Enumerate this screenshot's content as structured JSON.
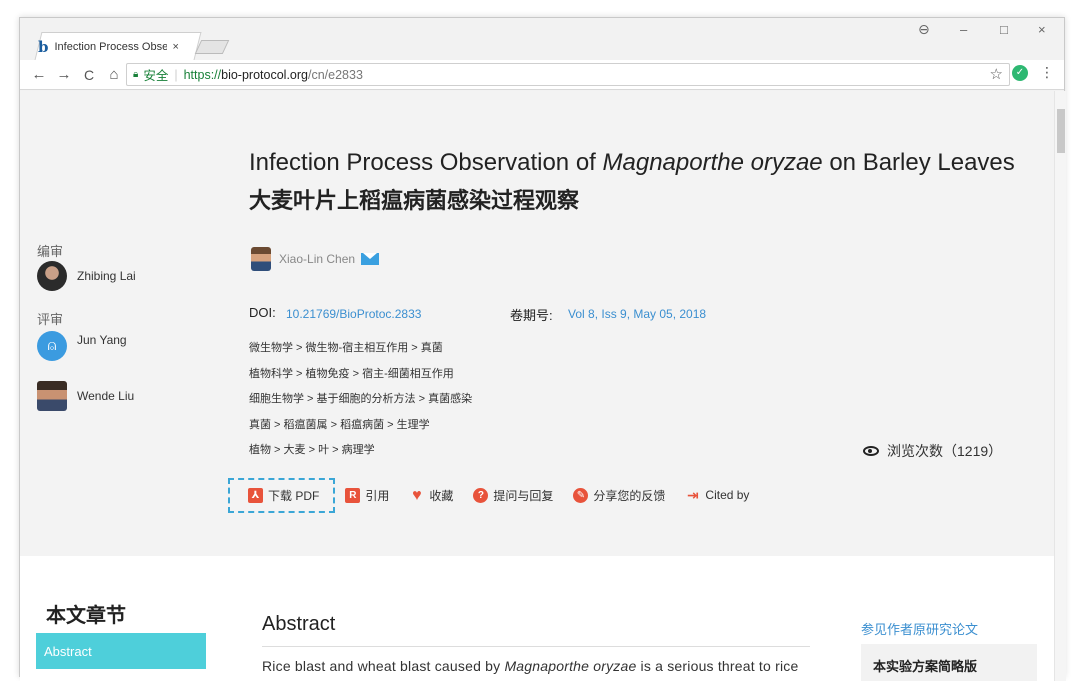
{
  "browser": {
    "tab_title": "Infection Process Obse",
    "tab_logo": "b",
    "tab_close": "×",
    "window_controls": [
      "–",
      "□",
      "×"
    ],
    "account_icon": "account-icon",
    "nav": {
      "back": "←",
      "forward": "→",
      "reload": "C",
      "home": "⌂"
    },
    "address": {
      "secure_label": "安全",
      "scheme": "https://",
      "host": "bio-protocol.org",
      "path": "/cn/e2833"
    },
    "bookmark_star": "☆",
    "menu": "⋮"
  },
  "article": {
    "title_en_before": "Infection Process Observation of ",
    "title_en_italic": "Magnaporthe oryzae",
    "title_en_after": " on Barley Leaves",
    "title_cn": "大麦叶片上稻瘟病菌感染过程观察",
    "author": "Xiao-Lin Chen",
    "doi_label": "DOI:",
    "doi": "10.21769/BioProtoc.2833",
    "issue_label": "卷期号:",
    "issue": "Vol 8, Iss 9, May 05, 2018",
    "categories": [
      "微生物学 > 微生物-宿主相互作用 > 真菌",
      "植物科学 > 植物免疫 > 宿主-细菌相互作用",
      "细胞生物学 > 基于细胞的分析方法 > 真菌感染",
      "真菌 > 稻瘟菌属 > 稻瘟病菌 > 生理学",
      "植物 > 大麦 > 叶 > 病理学"
    ],
    "views_label": "浏览次数（1219）"
  },
  "sidebar": {
    "editor_heading": "编审",
    "editors": [
      "Zhibing Lai"
    ],
    "reviewer_heading": "评审",
    "reviewers": [
      "Jun Yang",
      "Wende Liu"
    ]
  },
  "actions": [
    {
      "label": "下载 PDF",
      "icon": "pdf-icon",
      "color": "#e8533b"
    },
    {
      "label": "引用",
      "icon": "cite-icon",
      "color": "#e8533b"
    },
    {
      "label": "收藏",
      "icon": "heart-icon",
      "color": "#e8533b"
    },
    {
      "label": "提问与回复",
      "icon": "question-icon",
      "color": "#e8533b"
    },
    {
      "label": "分享您的反馈",
      "icon": "feedback-icon",
      "color": "#e8533b"
    },
    {
      "label": "Cited by",
      "icon": "cited-by-icon",
      "color": "#e8533b"
    }
  ],
  "lower": {
    "sections_heading": "本文章节",
    "active_section": "Abstract",
    "abstract_heading": "Abstract",
    "abstract_before": "Rice blast and wheat blast caused by ",
    "abstract_italic": "Magnaporthe oryzae",
    "abstract_after": " is a serious threat to rice",
    "see_original": "参见作者原研究论文",
    "summary_box": "本实验方案简略版"
  },
  "colors": {
    "link": "#3b8fd0",
    "accent": "#4ecfda",
    "action_icon": "#e8533b"
  }
}
